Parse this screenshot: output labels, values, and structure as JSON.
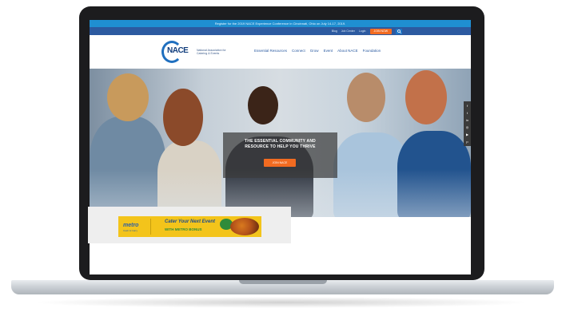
{
  "site": {
    "announcement": "Register for the 2019 NACE Experience Conference in Cincinnati, Ohio on July 14-17, 2019.",
    "utility": {
      "links": [
        "Blog",
        "Job Center",
        "Login"
      ],
      "join_label": "JOIN NOW",
      "search_icon": "search-icon"
    },
    "logo": {
      "wordmark": "NACE",
      "tagline": "National Association for Catering & Events"
    },
    "nav": [
      "Essential Resources",
      "Connect",
      "Grow",
      "Event",
      "About NACE",
      "Foundation"
    ],
    "hero": {
      "title_line1": "THE ESSENTIAL COMMUNITY AND",
      "title_line2": "RESOURCE TO HELP YOU THRIVE",
      "button_label": "JOIN NACE"
    },
    "social_icons": [
      "facebook-icon",
      "twitter-icon",
      "linkedin-icon",
      "instagram-icon",
      "youtube-icon",
      "pinterest-icon"
    ],
    "ad": {
      "brand": "metro",
      "brand_sub": "Cash & Carry",
      "tagline_line1": "Cater Your Next Event",
      "tagline_line2": "WITH METRO BONUS"
    }
  },
  "colors": {
    "announcement_bg": "#1f8fd1",
    "utility_bg": "#2c5aa0",
    "accent": "#f26b21",
    "logo_blue": "#1f6fbf",
    "ad_yellow": "#f3c41b"
  }
}
